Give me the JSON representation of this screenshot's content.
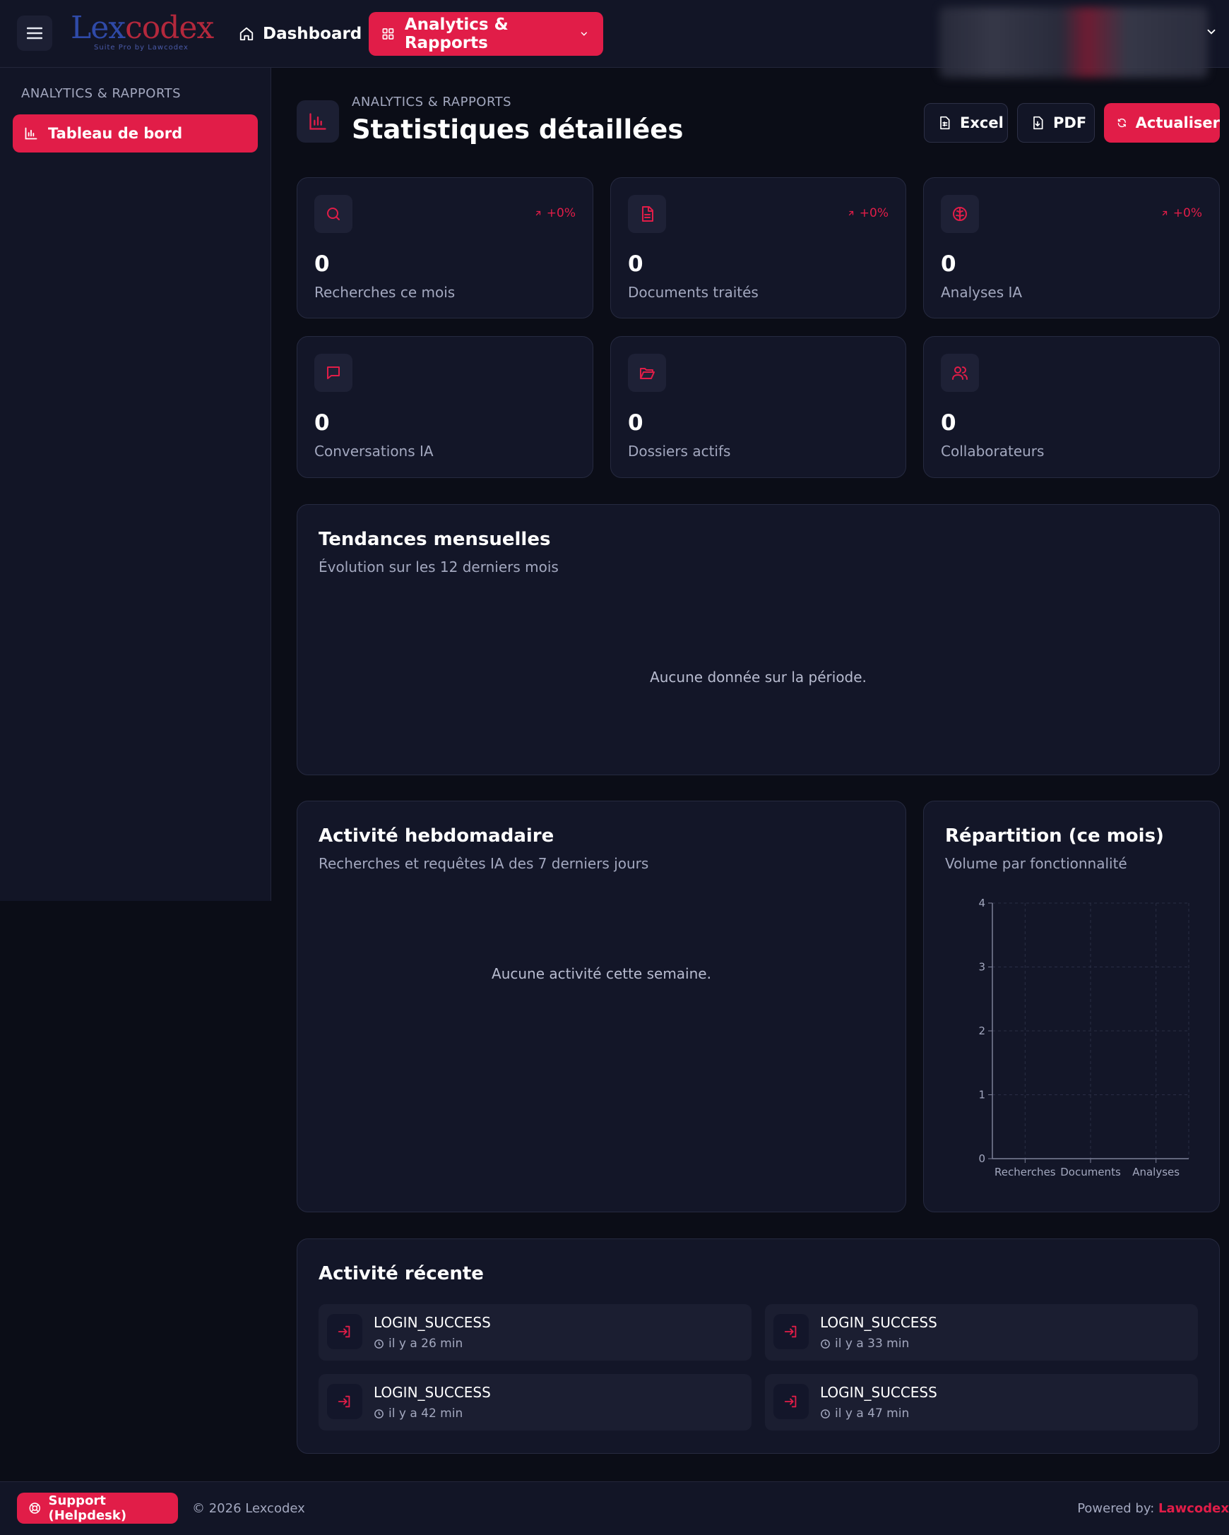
{
  "app": {
    "logo_main_1": "Lex",
    "logo_main_2": "codex",
    "logo_sub": "Suite Pro by Lawcodex"
  },
  "topnav": {
    "dashboard_label": "Dashboard",
    "analytics_label": "Analytics & Rapports"
  },
  "sidebar": {
    "section_title": "ANALYTICS & RAPPORTS",
    "items": [
      {
        "label": "Tableau de bord"
      }
    ]
  },
  "header": {
    "breadcrumb": "ANALYTICS & RAPPORTS",
    "title": "Statistiques détaillées",
    "excel_label": "Excel",
    "pdf_label": "PDF",
    "refresh_label": "Actualiser"
  },
  "stats": [
    {
      "value": "0",
      "label": "Recherches ce mois",
      "trend": "+0%",
      "icon": "search-icon"
    },
    {
      "value": "0",
      "label": "Documents traités",
      "trend": "+0%",
      "icon": "document-icon"
    },
    {
      "value": "0",
      "label": "Analyses IA",
      "trend": "+0%",
      "icon": "brain-icon"
    },
    {
      "value": "0",
      "label": "Conversations IA",
      "icon": "chat-icon"
    },
    {
      "value": "0",
      "label": "Dossiers actifs",
      "icon": "folder-icon"
    },
    {
      "value": "0",
      "label": "Collaborateurs",
      "icon": "users-icon"
    }
  ],
  "trends": {
    "title": "Tendances mensuelles",
    "subtitle": "Évolution sur les 12 derniers mois",
    "empty": "Aucune donnée sur la période."
  },
  "weekly": {
    "title": "Activité hebdomadaire",
    "subtitle": "Recherches et requêtes IA des 7 derniers jours",
    "empty": "Aucune activité cette semaine."
  },
  "repartition": {
    "title": "Répartition (ce mois)",
    "subtitle": "Volume par fonctionnalité"
  },
  "chart_data": {
    "type": "bar",
    "categories": [
      "Recherches",
      "Documents",
      "Analyses"
    ],
    "values": [
      0,
      0,
      0
    ],
    "yticks": [
      0,
      1,
      2,
      3,
      4
    ],
    "ylim": [
      0,
      4
    ],
    "grid": true
  },
  "recent": {
    "title": "Activité récente",
    "items": [
      {
        "name": "LOGIN_SUCCESS",
        "time": "il y a 26 min"
      },
      {
        "name": "LOGIN_SUCCESS",
        "time": "il y a 33 min"
      },
      {
        "name": "LOGIN_SUCCESS",
        "time": "il y a 42 min"
      },
      {
        "name": "LOGIN_SUCCESS",
        "time": "il y a 47 min"
      }
    ]
  },
  "footer": {
    "support_label": "Support (Helpdesk)",
    "copyright": "© 2026 Lexcodex",
    "powered_prefix": "Powered by:",
    "powered_brand": "Lawcodex"
  },
  "colors": {
    "accent": "#e11d48",
    "background": "#0b0d17",
    "panel": "#131628"
  }
}
